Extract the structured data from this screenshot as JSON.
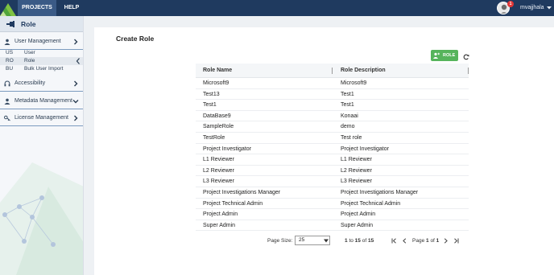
{
  "topbar": {
    "tabs": [
      {
        "label": "PROJECTS"
      },
      {
        "label": "HELP"
      }
    ],
    "notification_count": "1",
    "username": "mvajjhala"
  },
  "sidebar": {
    "title": "Role",
    "sections": [
      {
        "label": "User Management",
        "icon": "user-icon",
        "expanded": true
      },
      {
        "label": "Accessibility",
        "icon": "headset-icon"
      },
      {
        "label": "Metadata Management",
        "icon": "user-icon",
        "expanded": true
      },
      {
        "label": "License Management",
        "icon": "key-icon"
      }
    ],
    "user_management_items": [
      {
        "code": "US",
        "name": "User"
      },
      {
        "code": "RO",
        "name": "Role"
      },
      {
        "code": "BU",
        "name": "Bulk User Import"
      }
    ]
  },
  "main": {
    "title": "Create Role",
    "add_role_label": "ROLE",
    "grid": {
      "columns": [
        "Role Name",
        "Role Description"
      ],
      "rows": [
        [
          "Microsoft9",
          "Microsoft9"
        ],
        [
          "Test13",
          "Test1"
        ],
        [
          "Test1",
          "Test1"
        ],
        [
          "DataBase9",
          "Konaai"
        ],
        [
          "SampleRole",
          "demo"
        ],
        [
          "TestRole",
          "Test role"
        ],
        [
          "Project Investigator",
          "Project Investigator"
        ],
        [
          "L1 Reviewer",
          "L1 Reviewer"
        ],
        [
          "L2 Reviewer",
          "L2 Reviewer"
        ],
        [
          "L3 Reviewer",
          "L3 Reviewer"
        ],
        [
          "Project Investigations Manager",
          "Project Investigations Manager"
        ],
        [
          "Project Technical Admin",
          "Project Technical Admin"
        ],
        [
          "Project Admin",
          "Project Admin"
        ],
        [
          "Super Admin",
          "Super Admin"
        ]
      ]
    },
    "pager": {
      "page_size_label": "Page Size:",
      "page_size": "25",
      "range_from": "1",
      "to_word": "to",
      "range_to": "15",
      "of_word": "of",
      "total": "15",
      "page_word": "Page",
      "page_current": "1",
      "page_of_word": "of",
      "page_total": "1"
    }
  },
  "colors": {
    "topbar": "#1f3a5f",
    "active_tab": "#3a5a86",
    "add_button": "#56b45c",
    "notification": "#e23636"
  }
}
